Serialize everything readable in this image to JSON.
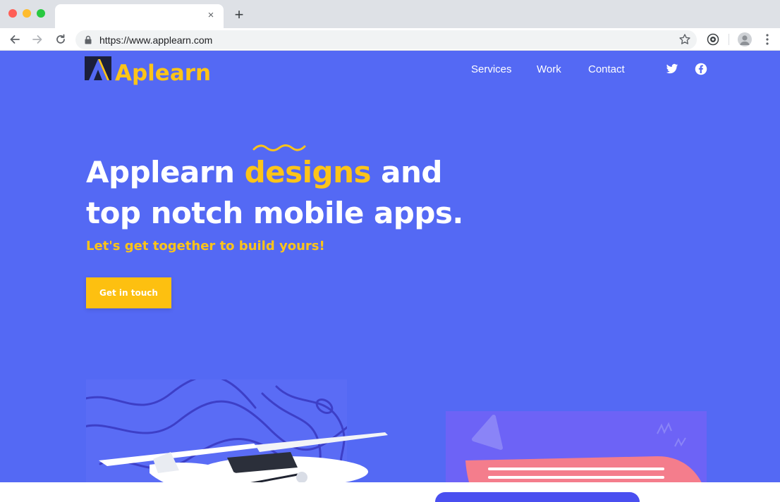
{
  "browser": {
    "url": "https://www.applearn.com",
    "tab_close_symbol": "×",
    "new_tab_symbol": "+"
  },
  "colors": {
    "page_background": "#5469f4",
    "accent": "#fcc419",
    "button": "#fdc010",
    "text": "#ffffff"
  },
  "site": {
    "logo_text": "Aplearn",
    "nav": {
      "services": "Services",
      "work": "Work",
      "contact": "Contact"
    },
    "social_icons": [
      "twitter-icon",
      "facebook-icon"
    ]
  },
  "hero": {
    "title_part1": "Applearn ",
    "title_highlight": "designs",
    "title_part2": " and top notch mobile apps.",
    "subtitle": "Let's get together to build yours!",
    "cta_label": "Get in touch"
  }
}
